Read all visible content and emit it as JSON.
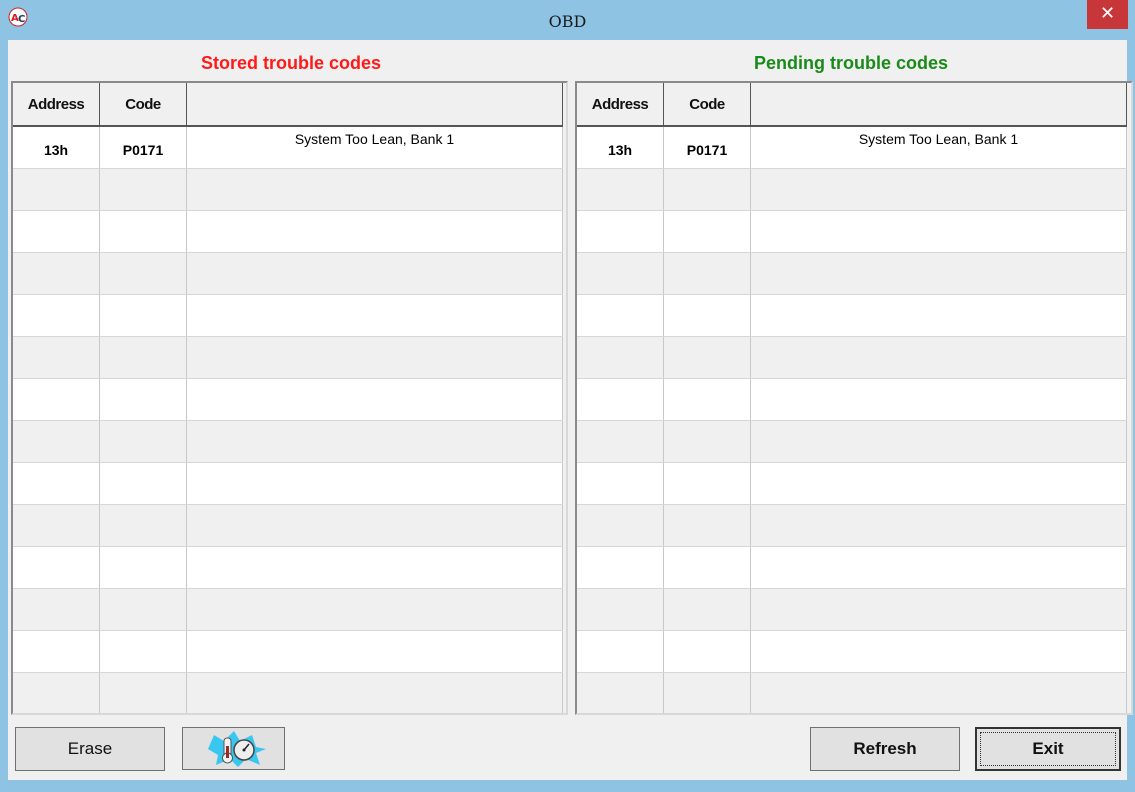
{
  "window": {
    "title": "OBD",
    "close_label": "✕"
  },
  "stored": {
    "title": "Stored trouble codes",
    "columns": [
      "Address",
      "Code",
      ""
    ],
    "rows": [
      {
        "address": "13h",
        "code": "P0171",
        "description": "System Too Lean, Bank 1"
      },
      {
        "address": "",
        "code": "",
        "description": ""
      },
      {
        "address": "",
        "code": "",
        "description": ""
      },
      {
        "address": "",
        "code": "",
        "description": ""
      },
      {
        "address": "",
        "code": "",
        "description": ""
      },
      {
        "address": "",
        "code": "",
        "description": ""
      },
      {
        "address": "",
        "code": "",
        "description": ""
      },
      {
        "address": "",
        "code": "",
        "description": ""
      },
      {
        "address": "",
        "code": "",
        "description": ""
      },
      {
        "address": "",
        "code": "",
        "description": ""
      },
      {
        "address": "",
        "code": "",
        "description": ""
      },
      {
        "address": "",
        "code": "",
        "description": ""
      },
      {
        "address": "",
        "code": "",
        "description": ""
      },
      {
        "address": "",
        "code": "",
        "description": ""
      }
    ]
  },
  "pending": {
    "title": "Pending trouble codes",
    "columns": [
      "Address",
      "Code",
      ""
    ],
    "rows": [
      {
        "address": "13h",
        "code": "P0171",
        "description": "System Too Lean, Bank 1"
      },
      {
        "address": "",
        "code": "",
        "description": ""
      },
      {
        "address": "",
        "code": "",
        "description": ""
      },
      {
        "address": "",
        "code": "",
        "description": ""
      },
      {
        "address": "",
        "code": "",
        "description": ""
      },
      {
        "address": "",
        "code": "",
        "description": ""
      },
      {
        "address": "",
        "code": "",
        "description": ""
      },
      {
        "address": "",
        "code": "",
        "description": ""
      },
      {
        "address": "",
        "code": "",
        "description": ""
      },
      {
        "address": "",
        "code": "",
        "description": ""
      },
      {
        "address": "",
        "code": "",
        "description": ""
      },
      {
        "address": "",
        "code": "",
        "description": ""
      },
      {
        "address": "",
        "code": "",
        "description": ""
      },
      {
        "address": "",
        "code": "",
        "description": ""
      }
    ]
  },
  "buttons": {
    "erase": "Erase",
    "gauge_icon": "thermometer-gauge-icon",
    "refresh": "Refresh",
    "exit": "Exit"
  },
  "colors": {
    "titlebar": "#8ec3e4",
    "close": "#c7373a",
    "stored_title": "#ff1a1a",
    "pending_title": "#1a8a1a"
  }
}
